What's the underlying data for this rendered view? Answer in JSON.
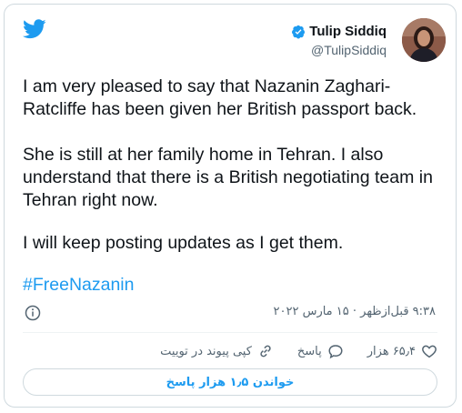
{
  "tweet": {
    "author_name": "Tulip Siddiq",
    "author_handle": "@TulipSiddiq",
    "paragraphs": [
      "I am very pleased to say that Nazanin Zaghari-Ratcliffe has been given her British passport back.",
      "She is still at her family home in Tehran. I also understand that there is a British negotiating team in Tehran right now.",
      "I will keep posting updates as I get them."
    ],
    "hashtag": "#FreeNazanin",
    "timestamp": "۹:۳۸ قبل‌ازظهر · ۱۵ مارس ۲۰۲۲"
  },
  "actions": {
    "like_count": "۶۵٫۴ هزار",
    "reply_label": "پاسخ",
    "copy_link_label": "کپی پیوند در توییت"
  },
  "reply_button": {
    "label": "خواندن ۱٫۵ هزار پاسخ"
  },
  "colors": {
    "accent": "#1d9bf0",
    "text": "#0f1419",
    "secondary": "#536471",
    "border": "#cfd9de"
  }
}
